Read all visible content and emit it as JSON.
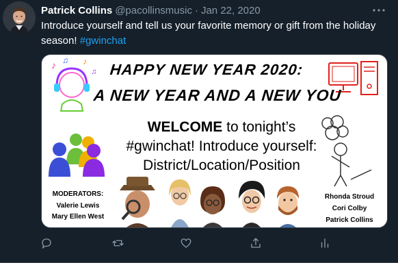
{
  "tweet": {
    "author": {
      "display_name": "Patrick Collins",
      "handle": "@pacollinsmusic",
      "separator": "·",
      "date": "Jan 22, 2020"
    },
    "more_icon": "more-horizontal-icon",
    "text_before": "Introduce yourself and tell us your favorite memory or gift from the holiday season! ",
    "hashtag": "#gwinchat"
  },
  "image": {
    "title_line1": "HAPPY NEW YEAR 2020:",
    "title_line2": "A NEW YEAR AND A NEW YOU",
    "welcome_bold": "WELCOME",
    "welcome_rest1": " to tonight’s",
    "welcome_line2": "#gwinchat! Introduce yourself:",
    "welcome_line3": "District/Location/Position",
    "moderators_heading": "MODERATORS:",
    "moderator_1": "Valerie Lewis",
    "moderator_2": "Mary Ellen West",
    "right_name_1": "Rhonda Stroud",
    "right_name_2": "Cori Colby",
    "right_name_3": "Patrick Collins"
  },
  "actions": [
    {
      "icon": "reply-icon"
    },
    {
      "icon": "retweet-icon"
    },
    {
      "icon": "like-icon"
    },
    {
      "icon": "share-icon"
    },
    {
      "icon": "analytics-icon"
    }
  ],
  "colors": {
    "background": "#15202b",
    "secondary_text": "#8899a6",
    "accent": "#1da1f2",
    "border": "#38444d"
  }
}
